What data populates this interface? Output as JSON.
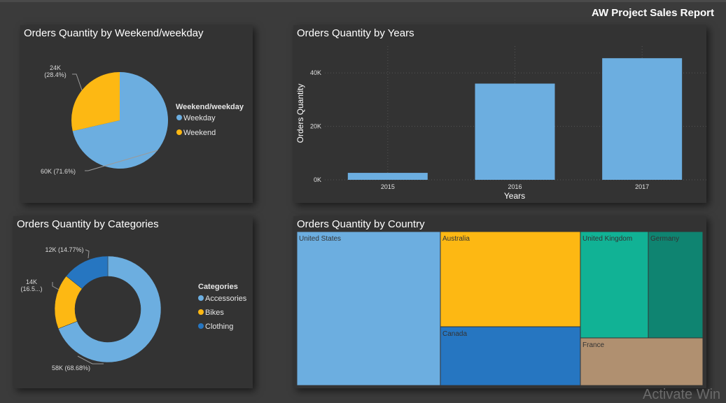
{
  "report": {
    "title": "AW Project Sales Report"
  },
  "colors": {
    "blue": "#6caee0",
    "yellow": "#fdb813",
    "darkblue": "#2676c1",
    "teal": "#11b295",
    "darkteal": "#0f8471",
    "tan": "#b09070"
  },
  "panels": {
    "weekend": {
      "title": "Orders Quantity by Weekend/weekday"
    },
    "years": {
      "title": "Orders Quantity by Years"
    },
    "categories": {
      "title": "Orders Quantity by Categories"
    },
    "country": {
      "title": "Orders Quantity by Country"
    }
  },
  "chart_data": [
    {
      "type": "pie",
      "title": "Orders Quantity by Weekend/weekday",
      "legend_title": "Weekend/weekday",
      "legend_position": "right",
      "slices": [
        {
          "name": "Weekday",
          "value": 60000,
          "label": "60K (71.6%)",
          "color": "#6caee0"
        },
        {
          "name": "Weekend",
          "value": 24000,
          "label": "24K\n(28.4%)",
          "color": "#fdb813"
        }
      ]
    },
    {
      "type": "bar",
      "title": "Orders Quantity by Years",
      "categories": [
        "2015",
        "2016",
        "2017"
      ],
      "values": [
        2600,
        36000,
        45500
      ],
      "xlabel": "Years",
      "ylabel": "Orders Quantity",
      "ylim": [
        0,
        50000
      ],
      "yticks": [
        {
          "value": 0,
          "label": "0K"
        },
        {
          "value": 20000,
          "label": "20K"
        },
        {
          "value": 40000,
          "label": "40K"
        }
      ],
      "grid": true,
      "color": "#6caee0"
    },
    {
      "type": "pie",
      "subtype": "donut",
      "title": "Orders Quantity by Categories",
      "legend_title": "Categories",
      "legend_position": "right",
      "slices": [
        {
          "name": "Accessories",
          "value": 58000,
          "label": "58K (68.68%)",
          "color": "#6caee0"
        },
        {
          "name": "Bikes",
          "value": 14000,
          "label": "14K\n(16.5...)",
          "color": "#fdb813"
        },
        {
          "name": "Clothing",
          "value": 12000,
          "label": "12K (14.77%)",
          "color": "#2676c1"
        }
      ]
    },
    {
      "type": "treemap",
      "title": "Orders Quantity by Country",
      "items": [
        {
          "name": "United States",
          "color": "#6caee0"
        },
        {
          "name": "Australia",
          "color": "#fdb813"
        },
        {
          "name": "Canada",
          "color": "#2676c1"
        },
        {
          "name": "United Kingdom",
          "color": "#11b295"
        },
        {
          "name": "Germany",
          "color": "#0f8471"
        },
        {
          "name": "France",
          "color": "#b09070"
        }
      ]
    }
  ],
  "watermark": {
    "text": "Activate Win"
  }
}
